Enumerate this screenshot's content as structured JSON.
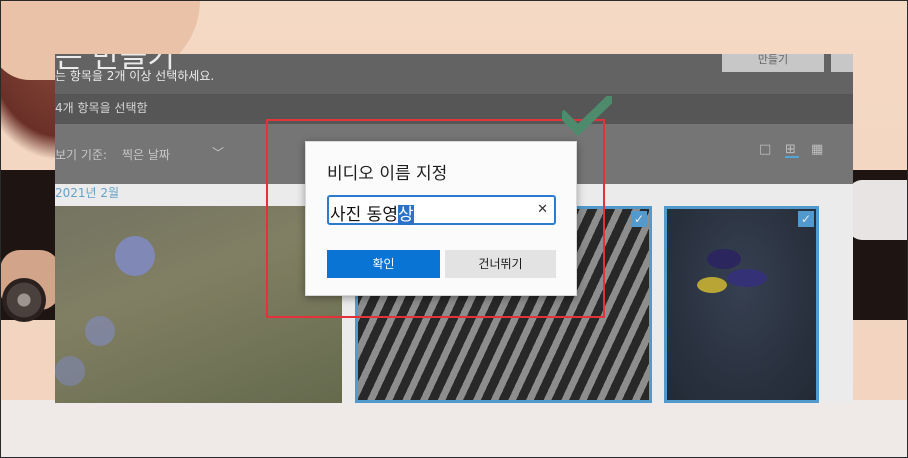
{
  "app": {
    "title": "는 만들기",
    "subtitle": "는 항목을 2개 이상 선택하세요.",
    "make_button": "만들기",
    "selected_count": "4개 항목을 선택함",
    "view_label": "보기 기준:",
    "sort_value": "찍은 날짜",
    "date_group": "2021년 2월"
  },
  "dialog": {
    "title": "비디오 이름 지정",
    "input_value_plain": "사진 동영",
    "input_value_selected": "상",
    "ok_label": "확인",
    "skip_label": "건너뛰기"
  },
  "icons": {
    "chevron": "chevron-down-icon",
    "clear": "close-icon",
    "check": "check-icon"
  },
  "colors": {
    "accent": "#0a74d4",
    "annotation_red": "#e2333b",
    "annotation_check": "#4e8a6c"
  }
}
